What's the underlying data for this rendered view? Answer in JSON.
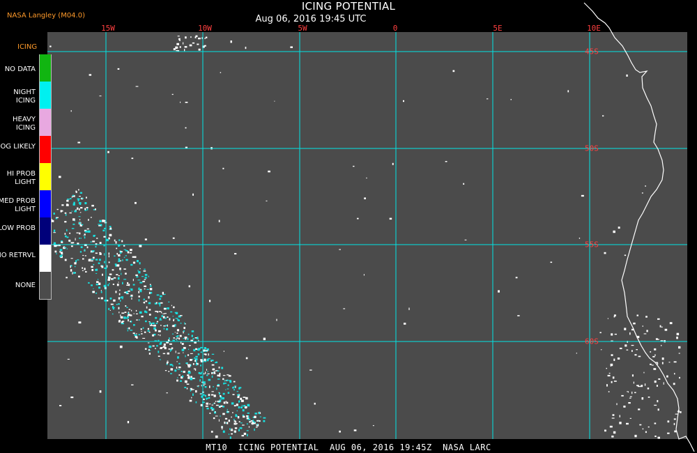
{
  "header": {
    "title": "ICING POTENTIAL",
    "datetime": "Aug 06, 2016 19:45 UTC",
    "source": "NASA Langley (M04.0)"
  },
  "longitude_labels": [
    "15W",
    "10W",
    "5W",
    "0",
    "5E",
    "10E"
  ],
  "latitude_labels": [
    "45S",
    "50S",
    "55S",
    "60S"
  ],
  "legend": {
    "title": "ICING",
    "items": [
      {
        "label": "NO DATA",
        "color": "#11b511"
      },
      {
        "label": "NIGHT ICING",
        "color": "#00f0f0"
      },
      {
        "label": "HEAVY ICING",
        "color": "#e8a8e0"
      },
      {
        "label": "MOG LIKELY",
        "color": "#ff0000"
      },
      {
        "label": "HI PROB LIGHT",
        "color": "#ffff00"
      },
      {
        "label": "MED PROB LIGHT",
        "color": "#0000ff"
      },
      {
        "label": "LOW PROB",
        "color": "#00007a"
      },
      {
        "label": "NO RETRVL",
        "color": "#ffffff"
      },
      {
        "label": "NONE",
        "color": "#4b4b4b"
      }
    ]
  },
  "footer": "MT10  ICING POTENTIAL  AUG 06, 2016 19:45Z  NASA LARC",
  "colors": {
    "background": "#4b4b4b",
    "grid": "#00e5e5",
    "coast": "#ffffff",
    "label": "#ff4040"
  }
}
